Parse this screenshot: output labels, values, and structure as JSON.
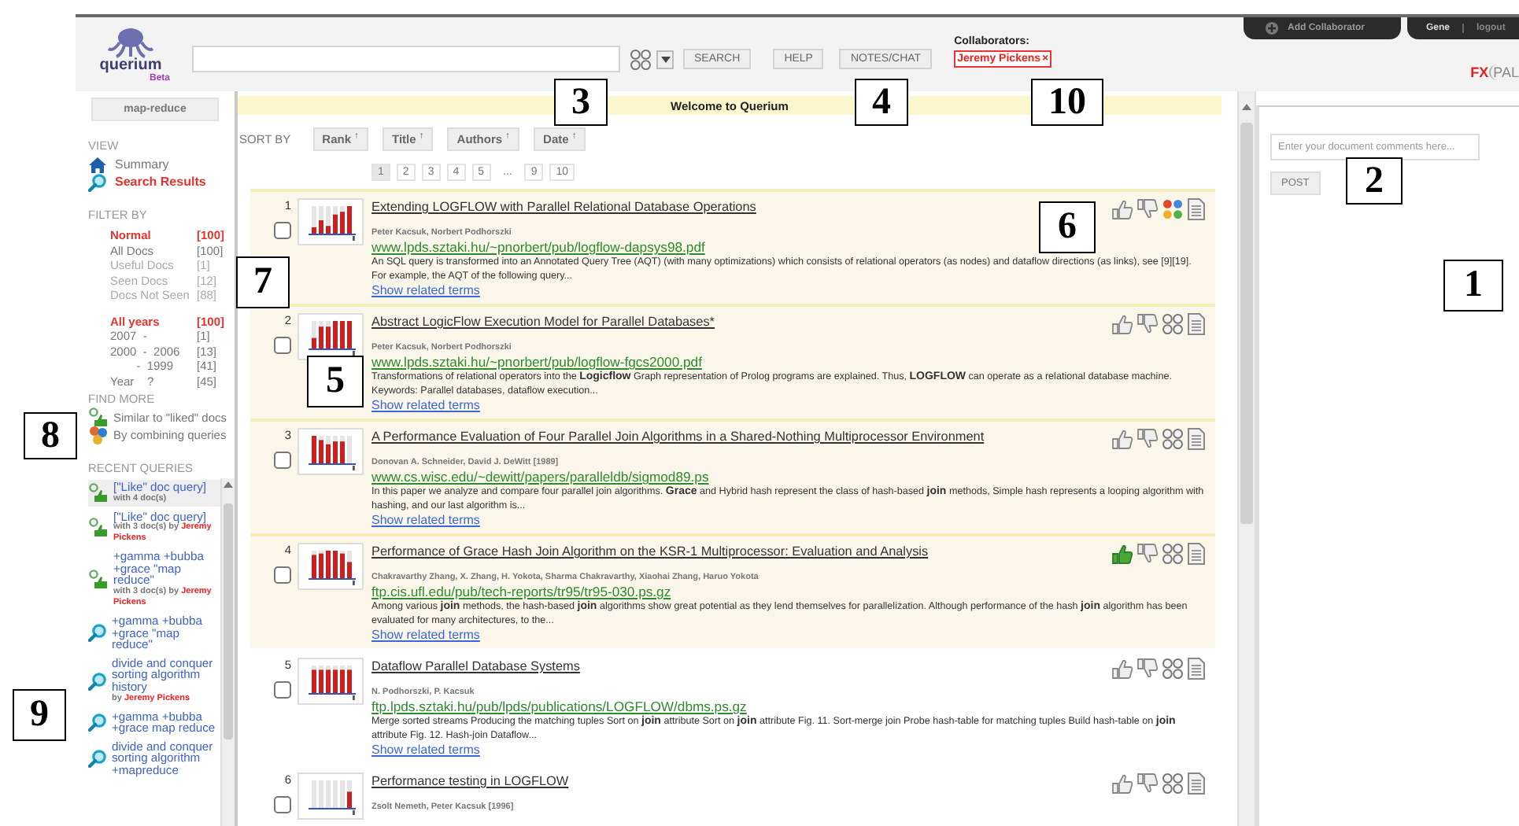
{
  "header": {
    "logo": {
      "name": "querium",
      "tag": "Beta"
    },
    "buttons": [
      {
        "label": "SEARCH"
      },
      {
        "label": "HELP"
      },
      {
        "label": "NOTES/CHAT"
      }
    ],
    "collaborators": {
      "label": "Collaborators:",
      "people": [
        {
          "name": "Jeremy Pickens",
          "remove": "×"
        }
      ]
    },
    "account": {
      "add_label": "Add Collaborator",
      "user": "Gene",
      "logout": "logout"
    },
    "brand": {
      "first": "FX",
      "second": "PAL"
    }
  },
  "sidebar": {
    "query_button": "map-reduce",
    "view": {
      "title": "VIEW",
      "items": [
        {
          "kind": "home",
          "label": "Summary",
          "selected": false
        },
        {
          "kind": "search",
          "label": "Search Results",
          "selected": true
        }
      ]
    },
    "filter": {
      "title": "FILTER BY",
      "groups": [
        [
          {
            "label": "Normal",
            "count": "[100]",
            "selected": true,
            "disabled": false
          },
          {
            "label": "All Docs",
            "count": "[100]",
            "selected": false,
            "disabled": false
          },
          {
            "label": "Useful Docs",
            "count": "[1]",
            "selected": false,
            "disabled": true
          },
          {
            "label": "Seen Docs",
            "count": "[12]",
            "selected": false,
            "disabled": true
          },
          {
            "label": "Docs Not Seen",
            "count": "[88]",
            "selected": false,
            "disabled": true
          }
        ],
        [
          {
            "label": "All years",
            "count": "[100]",
            "selected": true,
            "disabled": false
          },
          {
            "label": "2007  -",
            "count": "[1]",
            "selected": false,
            "disabled": false
          },
          {
            "label": "2000  -  2006",
            "count": "[13]",
            "selected": false,
            "disabled": false
          },
          {
            "label": "        -  1999",
            "count": "[41]",
            "selected": false,
            "disabled": false
          },
          {
            "label": "Year    ?",
            "count": "[45]",
            "selected": false,
            "disabled": false
          }
        ]
      ]
    },
    "find_more": {
      "title": "FIND MORE",
      "items": [
        {
          "kind": "like",
          "label": "Similar to \"liked\" docs"
        },
        {
          "kind": "combine",
          "label": "By combining queries"
        }
      ]
    },
    "recent": {
      "title": "RECENT QUERIES",
      "items": [
        {
          "kind": "like",
          "query": "[\"Like\" doc query]",
          "meta": "with 4 doc(s)",
          "selected": true
        },
        {
          "kind": "like",
          "query": "[\"Like\" doc query]",
          "meta": "with 3 doc(s) by",
          "user": "Jeremy Pickens",
          "selected": false
        },
        {
          "kind": "like",
          "query": "+gamma +bubba +grace \"map reduce\"",
          "meta": "with 3 doc(s) by",
          "user": "Jeremy Pickens",
          "selected": false
        },
        {
          "kind": "search",
          "query": "+gamma +bubba +grace \"map reduce\"",
          "selected": false
        },
        {
          "kind": "search",
          "query": "divide and conquer sorting algorithm history",
          "meta": "by",
          "user": "Jeremy Pickens",
          "selected": false
        },
        {
          "kind": "search",
          "query": "+gamma +bubba +grace map reduce",
          "selected": false
        },
        {
          "kind": "search",
          "query": "divide and conquer sorting algorithm +mapreduce",
          "selected": false
        }
      ]
    }
  },
  "main": {
    "banner": "Welcome to Querium",
    "sort": {
      "label": "SORT BY",
      "options": [
        {
          "label": "Rank",
          "arrow": "↑"
        },
        {
          "label": "Title",
          "arrow": "↑"
        },
        {
          "label": "Authors",
          "arrow": "↑"
        },
        {
          "label": "Date",
          "arrow": "↑"
        }
      ]
    },
    "pages": [
      {
        "label": "1",
        "selected": true
      },
      {
        "label": "2",
        "selected": false
      },
      {
        "label": "3",
        "selected": false
      },
      {
        "label": "4",
        "selected": false
      },
      {
        "label": "5",
        "selected": false
      },
      {
        "label": "...",
        "selected": false
      },
      {
        "label": "9",
        "selected": false
      },
      {
        "label": "10",
        "selected": false
      }
    ],
    "results": [
      {
        "number": "1",
        "title": "Extending LOGFLOW with Parallel Relational Database Operations",
        "authors": "Peter Kacsuk, Norbert Podhorszki",
        "url": "www.lpds.sztaki.hu/~pnorbert/pub/logflow-dapsys98.pdf",
        "snippet": "An SQL query is transformed into an Annotated Query Tree (AQT) (with many optimizations) which consists of relational operators (as nodes) and dataflow directions (as links), see [9][19]. For example, the AQT of the following query...",
        "related": "Show related terms",
        "checked": false,
        "seen": true,
        "liked": false,
        "queried": true
      },
      {
        "number": "2",
        "title": "Abstract LogicFlow Execution Model for Parallel Databases*",
        "authors": "Peter Kacsuk, Norbert Podhorszki",
        "url": "www.lpds.sztaki.hu/~pnorbert/pub/logflow-fgcs2000.pdf",
        "snippet": "Transformations of relational operators into the **Logicflow** Graph representation of Prolog programs are explained. Thus, **LOGFLOW** can operate as a relational database machine. Keywords: Parallel databases, dataflow execution...",
        "related": "Show related terms",
        "checked": false,
        "seen": true,
        "liked": false,
        "queried": false
      },
      {
        "number": "3",
        "title": "A Performance Evaluation of Four Parallel Join Algorithms in a Shared-Nothing Multiprocessor Environment",
        "authors": "Donovan A. Schneider, David J. DeWitt [1989]",
        "url": "www.cs.wisc.edu/~dewitt/papers/paralleldb/sigmod89.ps",
        "snippet": "In this paper we analyze and compare four parallel join algorithms. **Grace** and Hybrid hash represent the class of hash-based **join** methods, Simple hash represents a looping algorithm with hashing, and our last algorithm is...",
        "related": "Show related terms",
        "checked": false,
        "seen": true,
        "liked": false,
        "queried": false
      },
      {
        "number": "4",
        "title": "Performance of Grace Hash Join Algorithm on the KSR-1 Multiprocessor: Evaluation and Analysis",
        "authors": "Chakravarthy Zhang, X. Zhang, H. Yokota, Sharma Chakravarthy, Xiaohai Zhang, Haruo Yokota",
        "url": "ftp.cis.ufl.edu/pub/tech-reports/tr95/tr95-030.ps.gz",
        "snippet": "Among various **join** methods, the hash-based **join** algorithms show great potential as they lend themselves for parallelization. Although performance of the hash **join** algorithm has been evaluated for many architectures, to the...",
        "related": "Show related terms",
        "checked": false,
        "seen": true,
        "liked": true,
        "queried": false
      },
      {
        "number": "5",
        "title": "Dataflow Parallel Database Systems",
        "authors": "N. Podhorszki, P. Kacsuk",
        "url": "ftp.lpds.sztaki.hu/pub/lpds/publications/LOGFLOW/dbms.ps.gz",
        "snippet": "Merge sorted streams Producing the matching tuples Sort on **join** attribute Sort on **join** attribute Fig. 11. Sort-merge join Probe hash-table for matching tuples Build hash-table on **join** attribute Fig. 12. Hash-join  Dataflow...",
        "related": "Show related terms",
        "checked": false,
        "seen": false,
        "liked": false,
        "queried": false
      },
      {
        "number": "6",
        "title": "Performance testing in LOGFLOW",
        "authors": "Zsolt Nemeth, Peter Kacsuk [1996]",
        "checked": false,
        "seen": false,
        "liked": false,
        "queried": false
      }
    ]
  },
  "comments": {
    "placeholder": "Enter your document comments here...",
    "button": "POST"
  },
  "callouts": [
    {
      "label": "1"
    },
    {
      "label": "2"
    },
    {
      "label": "3"
    },
    {
      "label": "4"
    },
    {
      "label": "5"
    },
    {
      "label": "6"
    },
    {
      "label": "7"
    },
    {
      "label": "8"
    },
    {
      "label": "9"
    },
    {
      "label": "10"
    }
  ]
}
